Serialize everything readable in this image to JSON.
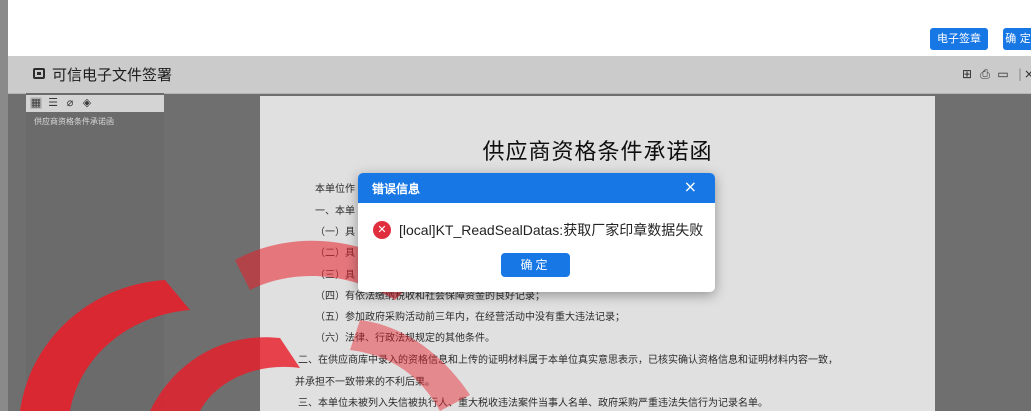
{
  "toolbar_top": {
    "sign_button": "电子签章",
    "confirm_button": "确 定"
  },
  "viewer": {
    "title": "可信电子文件签署",
    "sidebar": {
      "items": [
        "供应商资格条件承诺函"
      ]
    }
  },
  "document": {
    "title": "供应商资格条件承诺函",
    "lines": [
      "本单位作",
      "一、本单",
      "（一）具",
      "（二）具",
      "（三）具",
      "（四）有依法缴纳税收和社会保障资金的良好记录；",
      "（五）参加政府采购活动前三年内，在经营活动中没有重大违法记录；",
      "（六）法律、行政法规规定的其他条件。",
      "二、在供应商库中录入的资格信息和上传的证明材料属于本单位真实意思表示，已核实确认资格信息和证明材料内容一致，",
      "并承担不一致带来的不利后果。",
      "三、本单位未被列入失信被执行人、重大税收违法案件当事人名单、政府采购严重违法失信行为记录名单。"
    ]
  },
  "dialog": {
    "title": "错误信息",
    "close_glyph": "×",
    "message": "[local]KT_ReadSealDatas:获取厂家印章数据失败",
    "ok_label": "确定"
  },
  "colors": {
    "accent": "#1677e5",
    "error": "#e02e3e",
    "watermark": "#e81f2a"
  }
}
